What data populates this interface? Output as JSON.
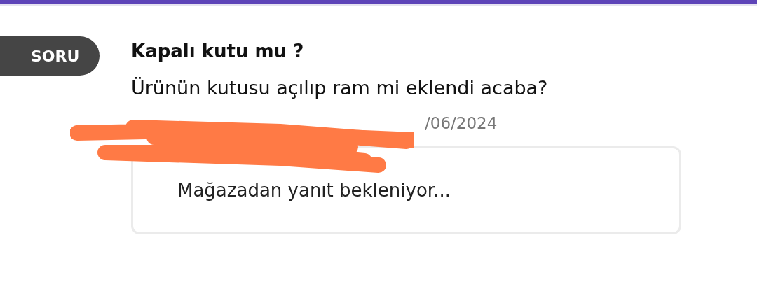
{
  "badge": {
    "label": "SORU"
  },
  "question": {
    "title": "Kapalı kutu mu ?",
    "body": "Ürünün kutusu açılıp ram mi eklendi acaba?",
    "date": "/06/2024",
    "redacted": true
  },
  "answer": {
    "status": "Mağazadan yanıt bekleniyor..."
  }
}
